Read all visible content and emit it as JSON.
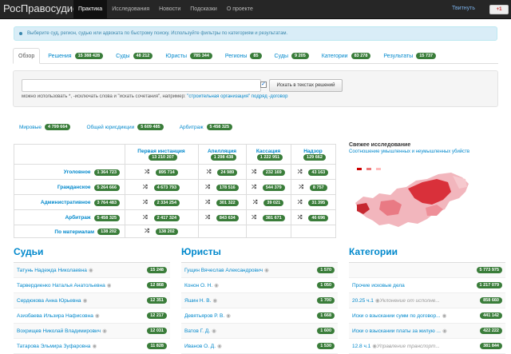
{
  "header": {
    "brand": "РосПравосудие",
    "nav": [
      "Практика",
      "Исследования",
      "Новости",
      "Подсказки",
      "О проекте"
    ],
    "tweet": "Твитнуть",
    "gplus": "+1"
  },
  "info": "Выберите суд, регион, судью или адвоката по быстрому поиску. Используйте фильтры по категориям и результатам.",
  "tabs": [
    {
      "label": "Обзор",
      "count": ""
    },
    {
      "label": "Решения",
      "count": "15 388 428"
    },
    {
      "label": "Суды",
      "count": "48 212"
    },
    {
      "label": "Юристы",
      "count": "785 344"
    },
    {
      "label": "Регионы",
      "count": "85"
    },
    {
      "label": "Суды",
      "count": "9 205"
    },
    {
      "label": "Категории",
      "count": "83 278"
    },
    {
      "label": "Результаты",
      "count": "15 737"
    }
  ],
  "search": {
    "placeholder": "",
    "button": "Искать в текстах решений",
    "hint_prefix": "можно использовать *, -исключать слова и \"искать сочетания\", например: ",
    "hint_link": "\"строительная организация\" подряд -договор"
  },
  "pills": [
    {
      "label": "Мировые",
      "count": "4 799 664"
    },
    {
      "label": "Общей юрисдикции",
      "count": "5 609 485"
    },
    {
      "label": "Арбитраж",
      "count": "5 458 325"
    }
  ],
  "table": {
    "columns": [
      {
        "label": "Первая инстанция",
        "count": "13 210 207"
      },
      {
        "label": "Апелляция",
        "count": "1 298 438"
      },
      {
        "label": "Кассация",
        "count": "1 222 951"
      },
      {
        "label": "Надзор",
        "count": "129 662"
      }
    ],
    "rows": [
      {
        "label": "Уголовное",
        "total": "1 364 723",
        "cells": [
          "895 714",
          "24 989",
          "232 169",
          "43 163"
        ]
      },
      {
        "label": "Гражданское",
        "total": "5 264 666",
        "cells": [
          "4 673 793",
          "178 516",
          "544 379",
          "8 757"
        ]
      },
      {
        "label": "Административное",
        "total": "3 764 483",
        "cells": [
          "2 334 254",
          "301 322",
          "39 021",
          "31 395"
        ]
      },
      {
        "label": "Арбитраж",
        "total": "5 458 325",
        "cells": [
          "2 417 324",
          "843 634",
          "381 671",
          "46 696"
        ]
      },
      {
        "label": "По материалам",
        "total": "138 202",
        "cells": [
          "138 202",
          "",
          "",
          ""
        ]
      }
    ]
  },
  "research": {
    "title": "Свежее исследование",
    "subtitle": "Соотношение умышленных и неумышленных убийств"
  },
  "judges": {
    "title": "Судьи",
    "items": [
      {
        "name": "Татунь Надежда Николаевна",
        "count": "15 248"
      },
      {
        "name": "Тарвердиенко Наталья Анатольевна",
        "count": "12 868"
      },
      {
        "name": "Сердюкова Анна Юрьевна",
        "count": "12 351"
      },
      {
        "name": "Азизбаева Ильзира Нафисовна",
        "count": "12 217"
      },
      {
        "name": "Вохрищев Николай Владимирович",
        "count": "12 031"
      },
      {
        "name": "Татарова Эльмира Зуфаровна",
        "count": "11 828"
      }
    ]
  },
  "lawyers": {
    "title": "Юристы",
    "items": [
      {
        "name": "Гущин Вячеслав Александрович",
        "count": "1 570"
      },
      {
        "name": "Конон О. Н.",
        "count": "1 050"
      },
      {
        "name": "Яшин Н. В.",
        "count": "1 700"
      },
      {
        "name": "Девятьяров Р. В.",
        "count": "1 668"
      },
      {
        "name": "Ватов Г. Д.",
        "count": "1 600"
      },
      {
        "name": "Иванов О. Д.",
        "count": "1 530"
      }
    ]
  },
  "categories": {
    "title": "Категории",
    "items": [
      {
        "name": "",
        "sub": "",
        "count": "5 773 975"
      },
      {
        "name": "Прочие исковые дела",
        "sub": "",
        "count": "1 217 079"
      },
      {
        "name": "20.25 ч.1",
        "sub": "Уклонение от исполне...",
        "count": "858 660"
      },
      {
        "name": "Иски о взыскании сумм по договор...",
        "sub": "",
        "count": "441 142"
      },
      {
        "name": "Иски о взыскании платы за жилую ...",
        "sub": "",
        "count": "422 222"
      },
      {
        "name": "12.8 ч.1",
        "sub": "Управление транспорт...",
        "count": "381 844"
      }
    ]
  }
}
